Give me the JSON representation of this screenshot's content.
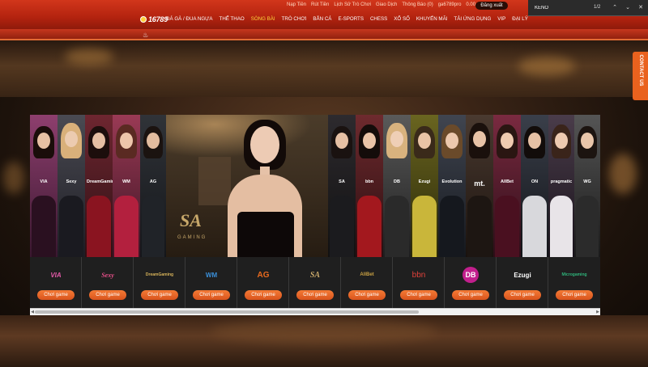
{
  "header": {
    "logo_text": "16789",
    "top_links": [
      "Nạp Tiền",
      "Rút Tiền",
      "Lịch Sử Trò Chơi",
      "Giao Dịch",
      "Thông Báo (0)",
      "ga6789pro",
      "0.00"
    ],
    "logout_label": "Đăng xuất",
    "nav": [
      {
        "label": "ĐÁ GÀ / ĐUA NGỰA",
        "active": false
      },
      {
        "label": "THỂ THAO",
        "active": false
      },
      {
        "label": "SÒNG BÀI",
        "active": true
      },
      {
        "label": "TRÒ CHƠI",
        "active": false
      },
      {
        "label": "BẮN CÁ",
        "active": false
      },
      {
        "label": "E-SPORTS",
        "active": false
      },
      {
        "label": "CHESS",
        "active": false
      },
      {
        "label": "XỔ SỐ",
        "active": false
      },
      {
        "label": "KHUYẾN MÃI",
        "active": false
      },
      {
        "label": "TẢI ỨNG DỤNG",
        "active": false
      },
      {
        "label": "VIP",
        "active": false
      },
      {
        "label": "ĐẠI LÝ",
        "active": false
      }
    ]
  },
  "find": {
    "query": "KENO",
    "count": "1/2",
    "up_icon": "chevron-up-icon",
    "down_icon": "chevron-down-icon",
    "close_icon": "close-icon"
  },
  "contact": {
    "label": "CONTACT US"
  },
  "banner": {
    "center_logo": "SA",
    "center_sub": "GAMING",
    "left_brands": [
      "VIA",
      "Sexy",
      "DreamGaming",
      "WM",
      "AG"
    ],
    "right_brands": [
      "SA",
      "bbn",
      "DB",
      "Ezugi",
      "Evolution",
      "mt.",
      "AllBet",
      "ON",
      "pragmatic",
      "WG"
    ]
  },
  "providers": [
    {
      "name": "VIA",
      "color": "#e35aa8",
      "button": "Chơi game"
    },
    {
      "name": "Sexy",
      "color": "#e8508a",
      "button": "Chơi game"
    },
    {
      "name": "DreamGaming",
      "color": "#d7b35a",
      "button": "Chơi game"
    },
    {
      "name": "WM",
      "color": "#3a8fd9",
      "button": "Chơi game"
    },
    {
      "name": "AG",
      "color": "#e86a1e",
      "button": "Chơi game"
    },
    {
      "name": "SA",
      "color": "#c8a86a",
      "button": "Chơi game"
    },
    {
      "name": "AllBet",
      "color": "#c9a143",
      "button": "Chơi game"
    },
    {
      "name": "bbn",
      "color": "#e0413a",
      "button": "Chơi game"
    },
    {
      "name": "DB",
      "color": "#c21f8d",
      "button": "Chơi game"
    },
    {
      "name": "Ezugi",
      "color": "#ffffff",
      "button": "Chơi game"
    },
    {
      "name": "Microgaming",
      "color": "#2fb37a",
      "button": "Chơi game"
    }
  ]
}
